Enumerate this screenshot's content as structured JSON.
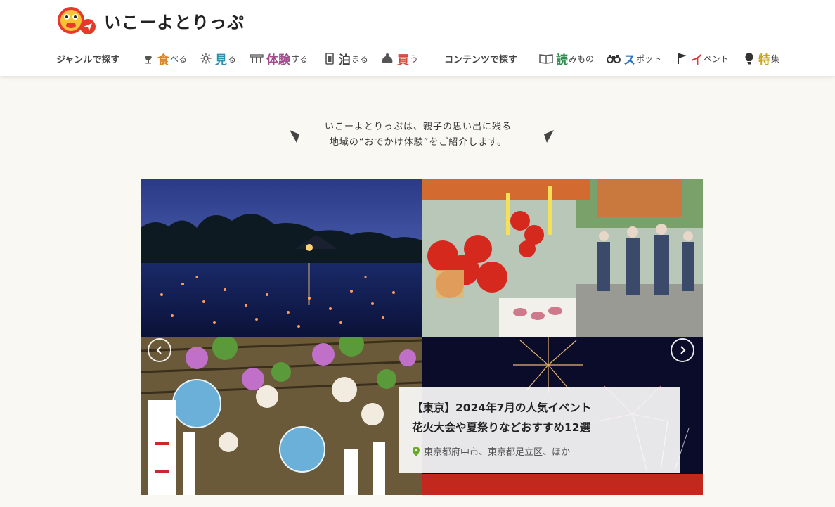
{
  "brand": {
    "name": "いこーよとりっぷ",
    "colors": {
      "red": "#e8382c",
      "yellow": "#f4c21d"
    }
  },
  "nav_genre": {
    "heading": "ジャンルで探す",
    "items": [
      {
        "big": "食",
        "small": "べる",
        "icon": "food-icon",
        "color": "#e4821c"
      },
      {
        "big": "見",
        "small": "る",
        "icon": "sparkle-icon",
        "color": "#2f8fb3"
      },
      {
        "big": "体験",
        "small": "する",
        "icon": "experience-icon",
        "color": "#a44a8f"
      },
      {
        "big": "泊",
        "small": "まる",
        "icon": "hotel-icon",
        "color": "#444444"
      },
      {
        "big": "買",
        "small": "う",
        "icon": "shopping-bag-icon",
        "color": "#d24a3b"
      }
    ]
  },
  "nav_content": {
    "heading": "コンテンツで探す",
    "items": [
      {
        "big": "読",
        "small": "みもの",
        "icon": "book-icon",
        "color": "#2d8f4e"
      },
      {
        "big": "ス",
        "small": "ポット",
        "icon": "binoculars-icon",
        "color": "#2f6fbf"
      },
      {
        "big": "イ",
        "small": "ベント",
        "icon": "flag-icon",
        "color": "#d33a3a"
      },
      {
        "big": "特",
        "small": "集",
        "icon": "lightbulb-icon",
        "color": "#c9a21a"
      }
    ]
  },
  "tagline": {
    "line1": "いこーよとりっぷは、親子の思い出に残る",
    "line2": "地域の“おでかけ体験”をご紹介します。"
  },
  "hero": {
    "title_line1": "【東京】2024年7月の人気イベント",
    "title_line2": "花火大会や夏祭りなどおすすめ12選",
    "location": "東京都府中市、東京都足立区、ほか"
  }
}
